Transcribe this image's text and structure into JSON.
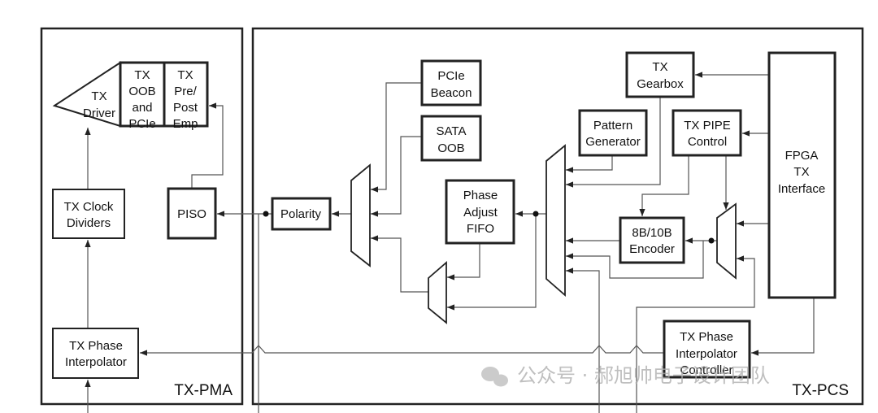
{
  "regions": {
    "pma": "TX-PMA",
    "pcs": "TX-PCS"
  },
  "blocks": {
    "tx_driver": [
      "TX",
      "Driver"
    ],
    "tx_oob": [
      "TX",
      "OOB",
      "and",
      "PCIe"
    ],
    "tx_prepost": [
      "TX",
      "Pre/",
      "Post",
      "Emp"
    ],
    "piso": [
      "PISO"
    ],
    "clock_dividers": [
      "TX Clock",
      "Dividers"
    ],
    "phase_interpolator": [
      "TX Phase",
      "Interpolator"
    ],
    "polarity": [
      "Polarity"
    ],
    "pcie_beacon": [
      "PCIe",
      "Beacon"
    ],
    "sata_oob": [
      "SATA",
      "OOB"
    ],
    "phase_fifo": [
      "Phase",
      "Adjust",
      "FIFO"
    ],
    "pattern_gen": [
      "Pattern",
      "Generator"
    ],
    "gearbox": [
      "TX",
      "Gearbox"
    ],
    "pipe_control": [
      "TX PIPE",
      "Control"
    ],
    "encoder": [
      "8B/10B",
      "Encoder"
    ],
    "fpga_if": [
      "FPGA",
      "TX",
      "Interface"
    ],
    "pi_controller": [
      "TX Phase",
      "Interpolator",
      "Controller"
    ]
  },
  "watermark": "公众号 · 郝旭帅电子设计团队"
}
